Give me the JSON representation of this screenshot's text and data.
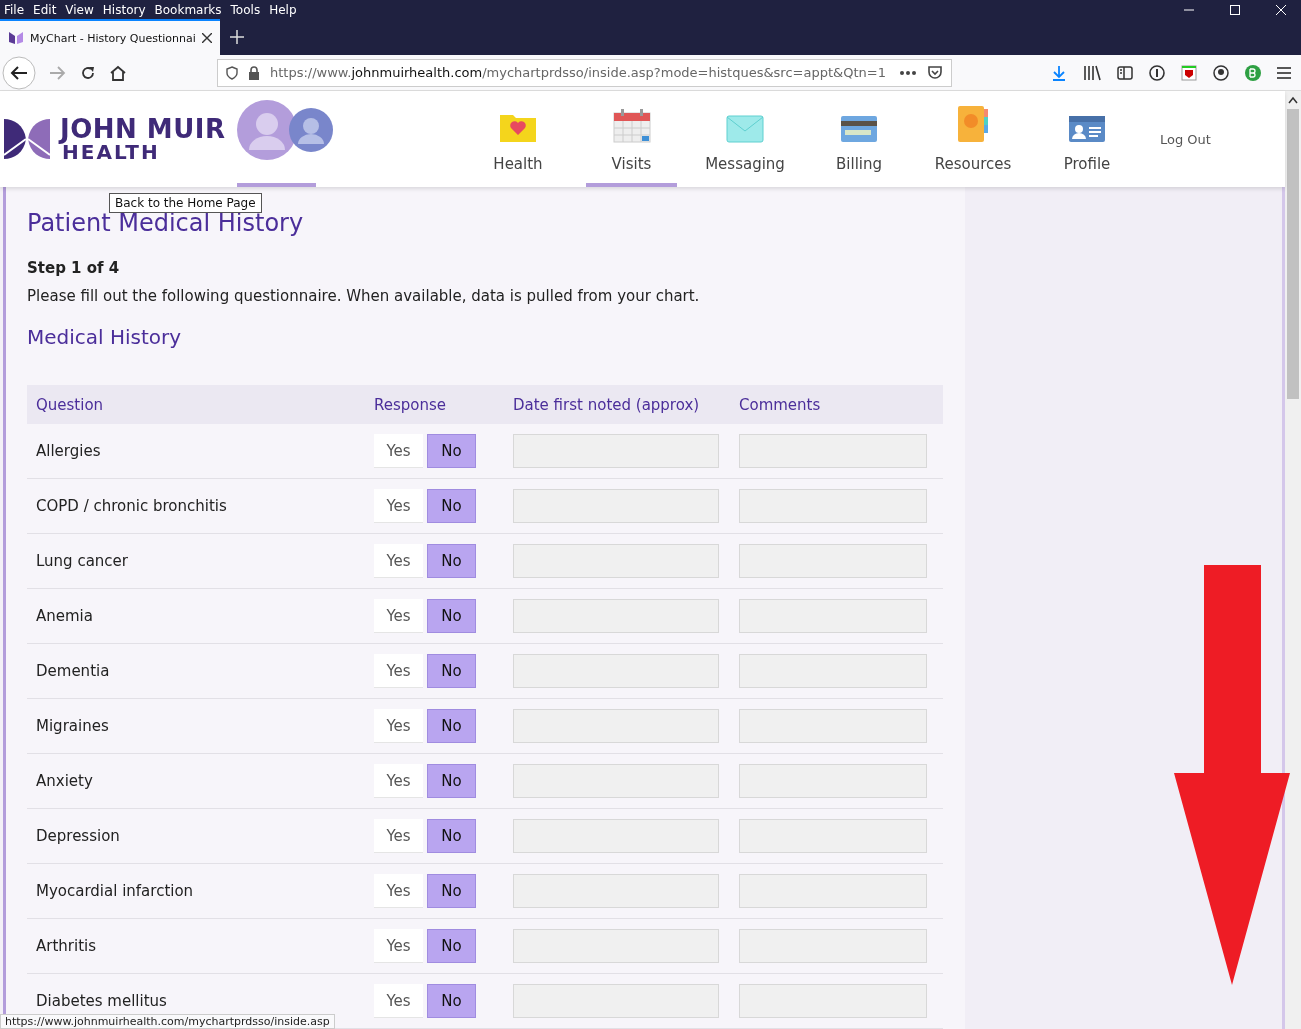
{
  "menu_bar": [
    "File",
    "Edit",
    "View",
    "History",
    "Bookmarks",
    "Tools",
    "Help"
  ],
  "tab": {
    "title": "MyChart - History Questionnai",
    "selected": true
  },
  "address_bar": {
    "prefix": "https://www.",
    "domain": "johnmuirhealth.com",
    "path": "/mychartprdsso/inside.asp?mode=histques&src=appt&Qtn=1"
  },
  "header": {
    "logo_line_1": "JOHN MUIR",
    "logo_line_2": "HEALTH",
    "nav": [
      {
        "label": "Health",
        "kind": "health",
        "selected": false
      },
      {
        "label": "Visits",
        "kind": "visits",
        "selected": true
      },
      {
        "label": "Messaging",
        "kind": "messaging",
        "selected": false
      },
      {
        "label": "Billing",
        "kind": "billing",
        "selected": false
      },
      {
        "label": "Resources",
        "kind": "resources",
        "selected": false
      },
      {
        "label": "Profile",
        "kind": "profile",
        "selected": false
      }
    ],
    "logout": "Log Out",
    "tooltip": "Back to the Home Page"
  },
  "page": {
    "title": "Patient Medical History",
    "step": "Step 1 of 4",
    "intro": "Please fill out the following questionnaire. When available, data is pulled from your chart.",
    "section": "Medical History"
  },
  "table": {
    "columns": [
      "Question",
      "Response",
      "Date first noted (approx)",
      "Comments"
    ],
    "rows": [
      {
        "question": "Allergies",
        "options": [
          {
            "label": "Yes",
            "selected": false
          },
          {
            "label": "No",
            "selected": true
          }
        ]
      },
      {
        "question": "COPD / chronic bronchitis",
        "options": [
          {
            "label": "Yes",
            "selected": false
          },
          {
            "label": "No",
            "selected": true
          }
        ]
      },
      {
        "question": "Lung cancer",
        "options": [
          {
            "label": "Yes",
            "selected": false
          },
          {
            "label": "No",
            "selected": true
          }
        ]
      },
      {
        "question": "Anemia",
        "options": [
          {
            "label": "Yes",
            "selected": false
          },
          {
            "label": "No",
            "selected": true
          }
        ]
      },
      {
        "question": "Dementia",
        "options": [
          {
            "label": "Yes",
            "selected": false
          },
          {
            "label": "No",
            "selected": true
          }
        ]
      },
      {
        "question": "Migraines",
        "options": [
          {
            "label": "Yes",
            "selected": false
          },
          {
            "label": "No",
            "selected": true
          }
        ]
      },
      {
        "question": "Anxiety",
        "options": [
          {
            "label": "Yes",
            "selected": false
          },
          {
            "label": "No",
            "selected": true
          }
        ]
      },
      {
        "question": "Depression",
        "options": [
          {
            "label": "Yes",
            "selected": false
          },
          {
            "label": "No",
            "selected": true
          }
        ]
      },
      {
        "question": "Myocardial infarction",
        "options": [
          {
            "label": "Yes",
            "selected": false
          },
          {
            "label": "No",
            "selected": true
          }
        ]
      },
      {
        "question": "Arthritis",
        "options": [
          {
            "label": "Yes",
            "selected": false
          },
          {
            "label": "No",
            "selected": true
          }
        ]
      },
      {
        "question": "Diabetes mellitus",
        "options": [
          {
            "label": "Yes",
            "selected": false
          },
          {
            "label": "No",
            "selected": true
          }
        ]
      }
    ]
  },
  "status_bar": "https://www.johnmuirhealth.com/mychartprdsso/inside.asp"
}
